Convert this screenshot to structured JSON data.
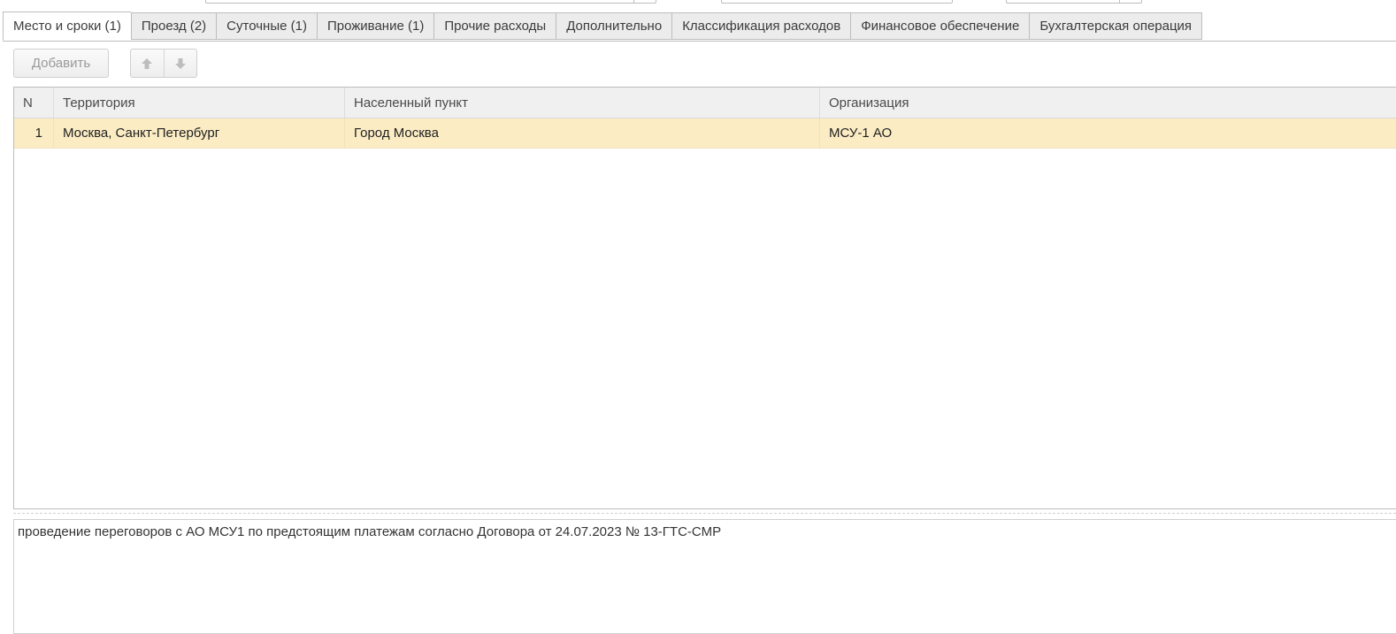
{
  "tabs": [
    {
      "label": "Место и сроки (1)",
      "active": true
    },
    {
      "label": "Проезд (2)"
    },
    {
      "label": "Суточные (1)"
    },
    {
      "label": "Проживание (1)"
    },
    {
      "label": "Прочие расходы"
    },
    {
      "label": "Дополнительно"
    },
    {
      "label": "Классификация расходов"
    },
    {
      "label": "Финансовое обеспечение"
    },
    {
      "label": "Бухгалтерская операция"
    }
  ],
  "toolbar": {
    "add_label": "Добавить",
    "move_up_icon": "arrow-up-icon",
    "move_down_icon": "arrow-down-icon"
  },
  "table": {
    "columns": [
      "N",
      "Территория",
      "Населенный пункт",
      "Организация"
    ],
    "rows": [
      {
        "n": "1",
        "territory": "Москва, Санкт-Петербург",
        "city": "Город Москва",
        "organization": "МСУ-1 АО",
        "selected": true
      }
    ]
  },
  "description": "проведение переговоров с АО МСУ1 по предстоящим платежам согласно Договора от 24.07.2023 № 13-ГТС-СМР",
  "colors": {
    "selected_row": "#fbecc4",
    "header_bg": "#f0f0f0",
    "tab_bg": "#ececec",
    "border": "#bdbdbd"
  }
}
